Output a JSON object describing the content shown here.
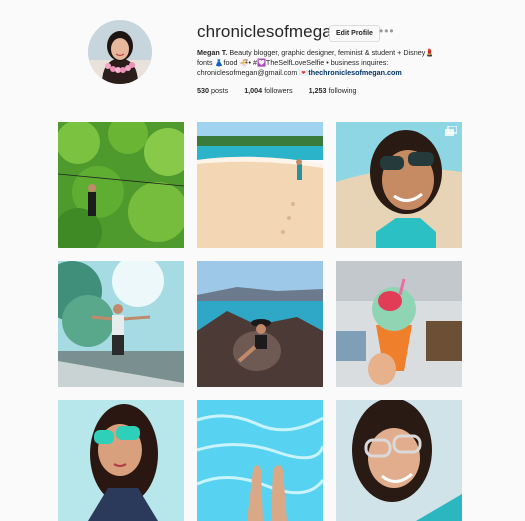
{
  "profile": {
    "username": "chroniclesofmegan",
    "edit_button_label": "Edit Profile",
    "more_label": "•••",
    "bio_name": "Megan T.",
    "bio_line1": " Beauty blogger, graphic designer, feminist & student + Disney💄",
    "bio_line2": "fonts 👗food 🍜• #💟TheSelfLoveSelfie • business inquires:",
    "bio_email": "chroniclesofmegan@gmail.com",
    "bio_link_emoji": "💌",
    "bio_link": "thechroniclesofmegan.com",
    "posts_count": "530",
    "posts_label": "posts",
    "followers_count": "1,004",
    "followers_label": "followers",
    "following_count": "1,253",
    "following_label": "following"
  },
  "icons": {
    "avatar": "profile-photo",
    "more": "more-options-icon",
    "multi": "multiple-photos-icon"
  },
  "colors": {
    "link": "#003569",
    "border": "#dbdbdb",
    "background": "#fafafa"
  }
}
